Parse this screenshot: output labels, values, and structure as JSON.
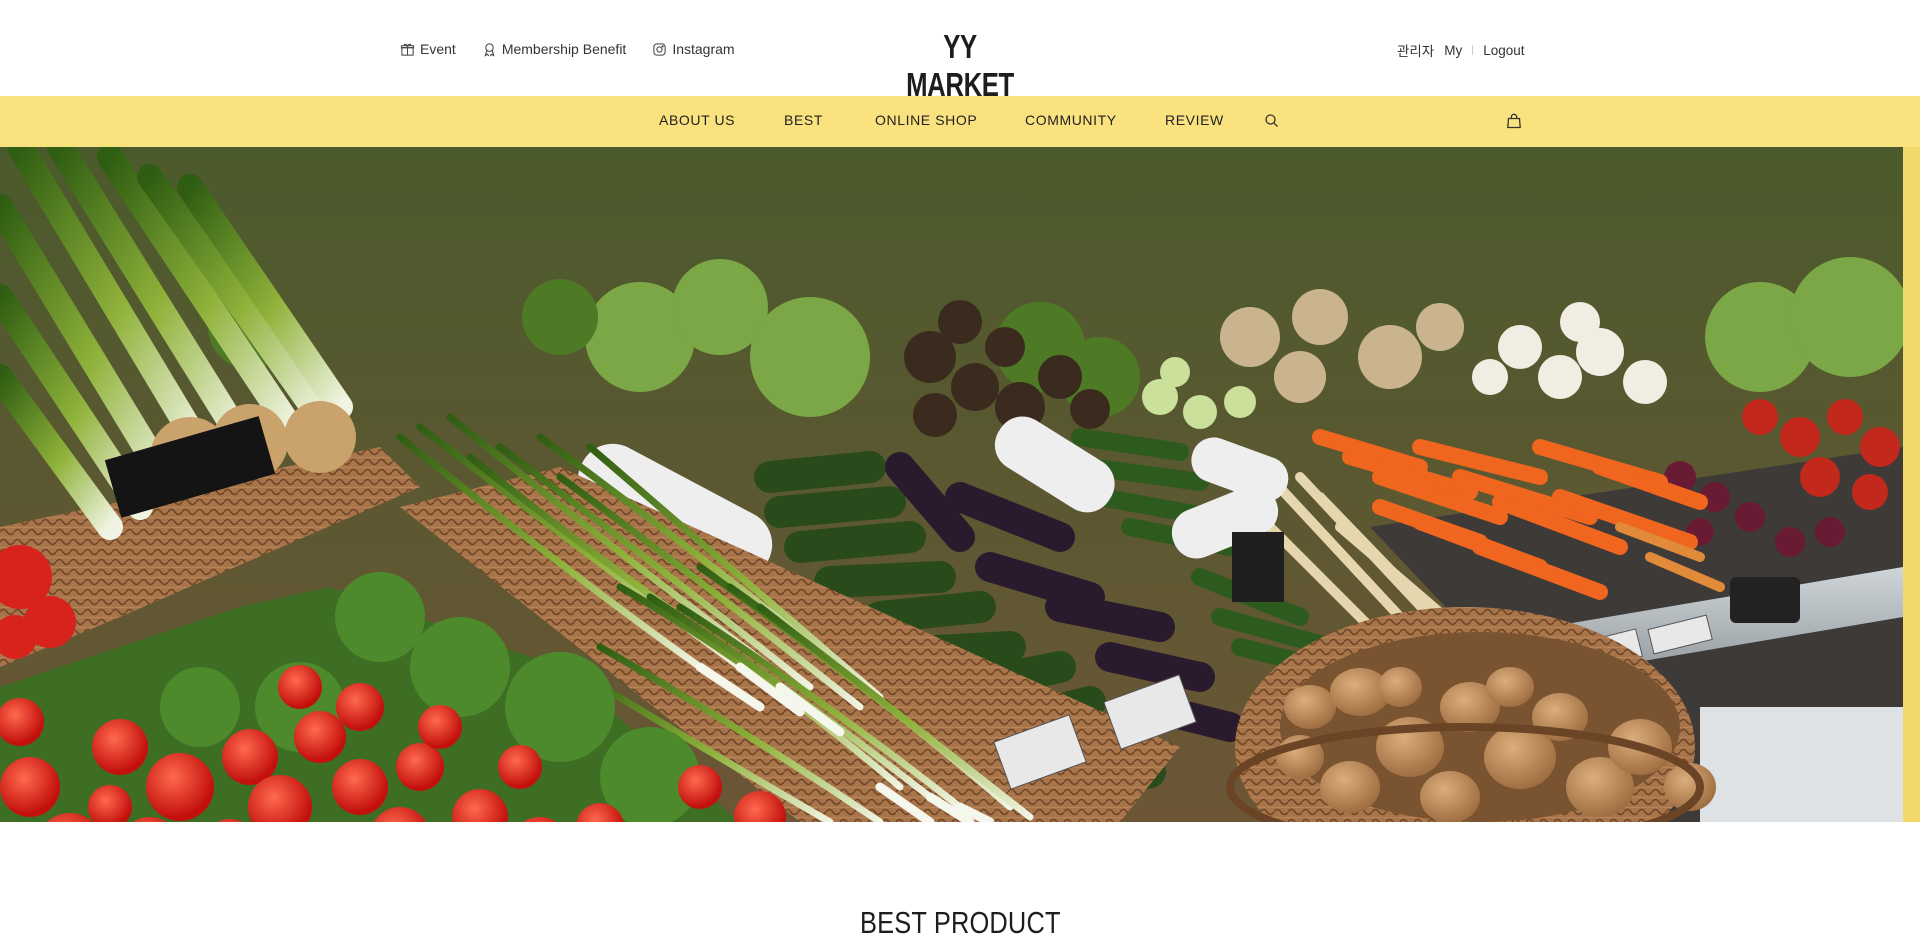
{
  "header": {
    "left_links": [
      {
        "label": "Event",
        "icon": "gift-icon"
      },
      {
        "label": "Membership Benefit",
        "icon": "award-icon"
      },
      {
        "label": "Instagram",
        "icon": "instagram-icon"
      }
    ],
    "logo": "YY MARKET",
    "user_links": {
      "admin": "관리자",
      "my": "My",
      "logout": "Logout"
    }
  },
  "nav": {
    "items": [
      "ABOUT US",
      "BEST",
      "ONLINE SHOP",
      "COMMUNITY",
      "REVIEW"
    ],
    "icons": [
      "search-icon",
      "shopping-bag-icon"
    ],
    "background": "#fae27f"
  },
  "hero": {
    "image": "vegetable-market-photo"
  },
  "best_section": {
    "title": "BEST PRODUCT"
  }
}
